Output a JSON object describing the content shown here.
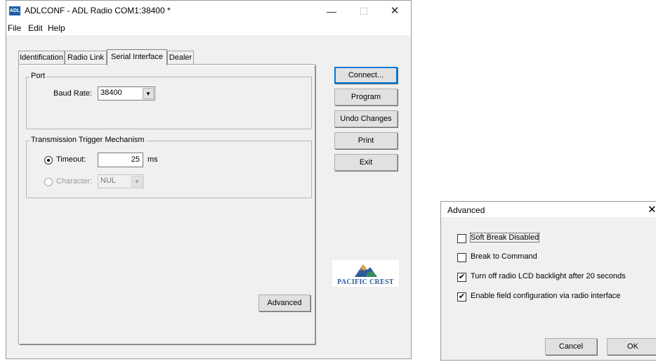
{
  "main_window": {
    "icon_text": "ADL",
    "title": "ADLCONF - ADL Radio COM1:38400 *",
    "controls": {
      "minimize": "—",
      "maximize": "☐",
      "close": "✕"
    }
  },
  "menu": {
    "file": "File",
    "edit": "Edit",
    "help": "Help"
  },
  "tabs": [
    {
      "label": "Identification"
    },
    {
      "label": "Radio Link"
    },
    {
      "label": "Serial Interface",
      "selected": true
    },
    {
      "label": "Dealer"
    }
  ],
  "port_group": {
    "title": "Port",
    "baud_label": "Baud Rate:",
    "baud_value": "38400"
  },
  "trigger_group": {
    "title": "Transmission Trigger Mechanism",
    "timeout_label": "Timeout:",
    "timeout_value": "25",
    "timeout_unit": "ms",
    "timeout_selected": true,
    "character_label": "Character:",
    "character_value": "NUL",
    "character_enabled": false
  },
  "buttons": {
    "advanced": "Advanced",
    "connect": "Connect...",
    "program": "Program",
    "undo": "Undo Changes",
    "print": "Print",
    "exit": "Exit"
  },
  "logo": {
    "text": "PACIFIC CREST",
    "colors": [
      "#2d5c97",
      "#e8a33a",
      "#3b8b5b"
    ]
  },
  "advanced_dialog": {
    "title": "Advanced",
    "close": "✕",
    "options": [
      {
        "label": "Soft Break Disabled",
        "checked": false
      },
      {
        "label": "Break to Command",
        "checked": false
      },
      {
        "label": "Turn off radio LCD backlight after 20 seconds",
        "checked": true
      },
      {
        "label": "Enable field configuration via radio interface",
        "checked": true
      }
    ],
    "cancel": "Cancel",
    "ok": "OK"
  }
}
